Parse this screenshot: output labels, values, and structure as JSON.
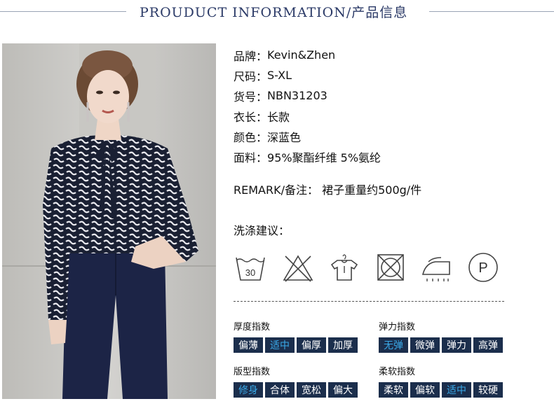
{
  "header": {
    "title": "PROUDUCT INFORMATION/产品信息"
  },
  "specs": [
    {
      "label": "品牌：",
      "value": "Kevin&Zhen"
    },
    {
      "label": "尺码：",
      "value": "S-XL"
    },
    {
      "label": "货号：",
      "value": "NBN31203"
    },
    {
      "label": "衣长：",
      "value": "长款"
    },
    {
      "label": "颜色：",
      "value": "深蓝色"
    },
    {
      "label": "面料：",
      "value": "95%聚酯纤维 5%氨纶"
    }
  ],
  "remark": {
    "label": "REMARK/备注：",
    "value": "裙子重量约500g/件"
  },
  "care": {
    "title": "洗涤建议：",
    "icons": [
      "wash-30-icon",
      "do-not-bleach-icon",
      "hang-dry-icon",
      "do-not-tumble-dry-icon",
      "iron-steam-icon",
      "professional-dry-clean-p-icon"
    ],
    "wash_temp": "30",
    "dry_clean_letter": "P"
  },
  "indices": [
    {
      "title": "厚度指数",
      "options": [
        "偏薄",
        "适中",
        "偏厚",
        "加厚"
      ],
      "selected": "适中"
    },
    {
      "title": "弹力指数",
      "options": [
        "无弹",
        "微弹",
        "弹力",
        "高弹"
      ],
      "selected": "无弹"
    },
    {
      "title": "版型指数",
      "options": [
        "修身",
        "合体",
        "宽松",
        "偏大"
      ],
      "selected": "修身"
    },
    {
      "title": "柔软指数",
      "options": [
        "柔软",
        "偏软",
        "适中",
        "较硬"
      ],
      "selected": "适中"
    }
  ],
  "colors": {
    "chip_bg": "#1b2e4c",
    "chip_text": "#ffffff",
    "chip_active_text": "#3aa9e8",
    "header_text": "#2b3a67"
  }
}
